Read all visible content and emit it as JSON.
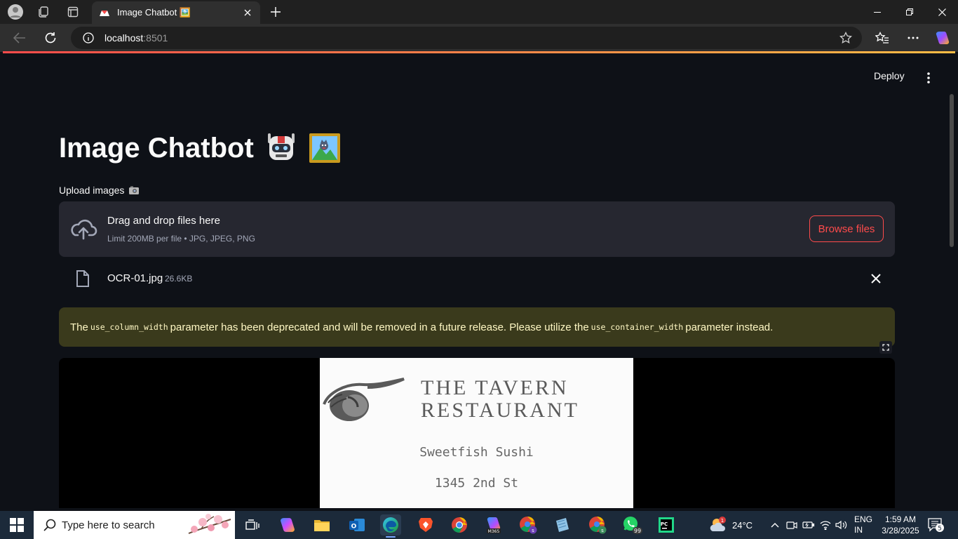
{
  "browser": {
    "tab_title": "Image Chatbot 🖼️",
    "url_host": "localhost",
    "url_port": ":8501"
  },
  "app": {
    "deploy_label": "Deploy",
    "title": "Image Chatbot",
    "upload_label": "Upload images",
    "dropzone": {
      "title": "Drag and drop files here",
      "limit": "Limit 200MB per file • JPG, JPEG, PNG",
      "browse_label": "Browse files"
    },
    "file": {
      "name": "OCR-01.jpg",
      "size": "26.6KB"
    },
    "warning": {
      "part1": "The",
      "code1": "use_column_width",
      "part2": "parameter has been deprecated and will be removed in a future release. Please utilize the",
      "code2": "use_container_width",
      "part3": "parameter instead."
    },
    "image_text": {
      "line1": "THE TAVERN",
      "line2": "RESTAURANT",
      "line3": "Sweetfish Sushi",
      "line4": "1345 2nd St"
    }
  },
  "taskbar": {
    "search_placeholder": "Type here to search",
    "weather_temp": "24°C",
    "weather_badge": "1",
    "lang_line1": "ENG",
    "lang_line2": "IN",
    "time": "1:59 AM",
    "date": "3/28/2025",
    "notifications_count": "5",
    "whatsapp_badge": "99"
  },
  "colors": {
    "accent": "#ff4b4b",
    "page_bg": "#0e1117",
    "warning_bg": "#3a3a1c"
  }
}
